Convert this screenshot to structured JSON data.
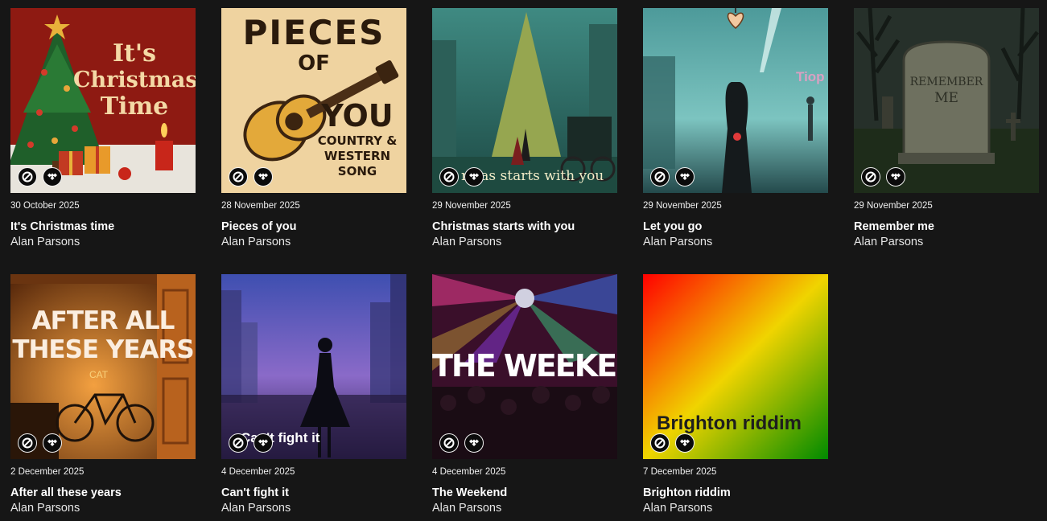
{
  "releases": [
    {
      "date": "30 October 2025",
      "title": "It's Christmas time",
      "artist": "Alan Parsons",
      "cover_text": [
        "It's",
        "Christmas",
        "Time"
      ]
    },
    {
      "date": "28 November 2025",
      "title": "Pieces of you",
      "artist": "Alan Parsons",
      "cover_text": [
        "PIECES",
        "OF",
        "YOU",
        "COUNTRY &",
        "WESTERN",
        "SONG"
      ]
    },
    {
      "date": "29 November 2025",
      "title": "Christmas starts with you",
      "artist": "Alan Parsons",
      "cover_text": [
        "rmas starts with you"
      ]
    },
    {
      "date": "29 November 2025",
      "title": "Let you go",
      "artist": "Alan Parsons",
      "cover_text": [
        "Tiop"
      ]
    },
    {
      "date": "29 November 2025",
      "title": "Remember me",
      "artist": "Alan Parsons",
      "cover_text": [
        "REMEMBER",
        "ME"
      ]
    },
    {
      "date": "2 December 2025",
      "title": "After all these years",
      "artist": "Alan Parsons",
      "cover_text": [
        "AFTER ALL",
        "THESE YEARS",
        "CAT"
      ]
    },
    {
      "date": "4 December 2025",
      "title": "Can't fight it",
      "artist": "Alan Parsons",
      "cover_text": [
        "Can't fight it"
      ]
    },
    {
      "date": "4 December 2025",
      "title": "The Weekend",
      "artist": "Alan Parsons",
      "cover_text": [
        "THE WEEKEND"
      ]
    },
    {
      "date": "7 December 2025",
      "title": "Brighton riddim",
      "artist": "Alan Parsons",
      "cover_text": [
        "Brighton riddim"
      ]
    }
  ],
  "badges": {
    "first": "blocked-circle-icon",
    "second": "tidal-icon"
  },
  "colors": {
    "background": "#161616",
    "text": "#ffffff",
    "badge_bg": "#0b0b0b"
  }
}
